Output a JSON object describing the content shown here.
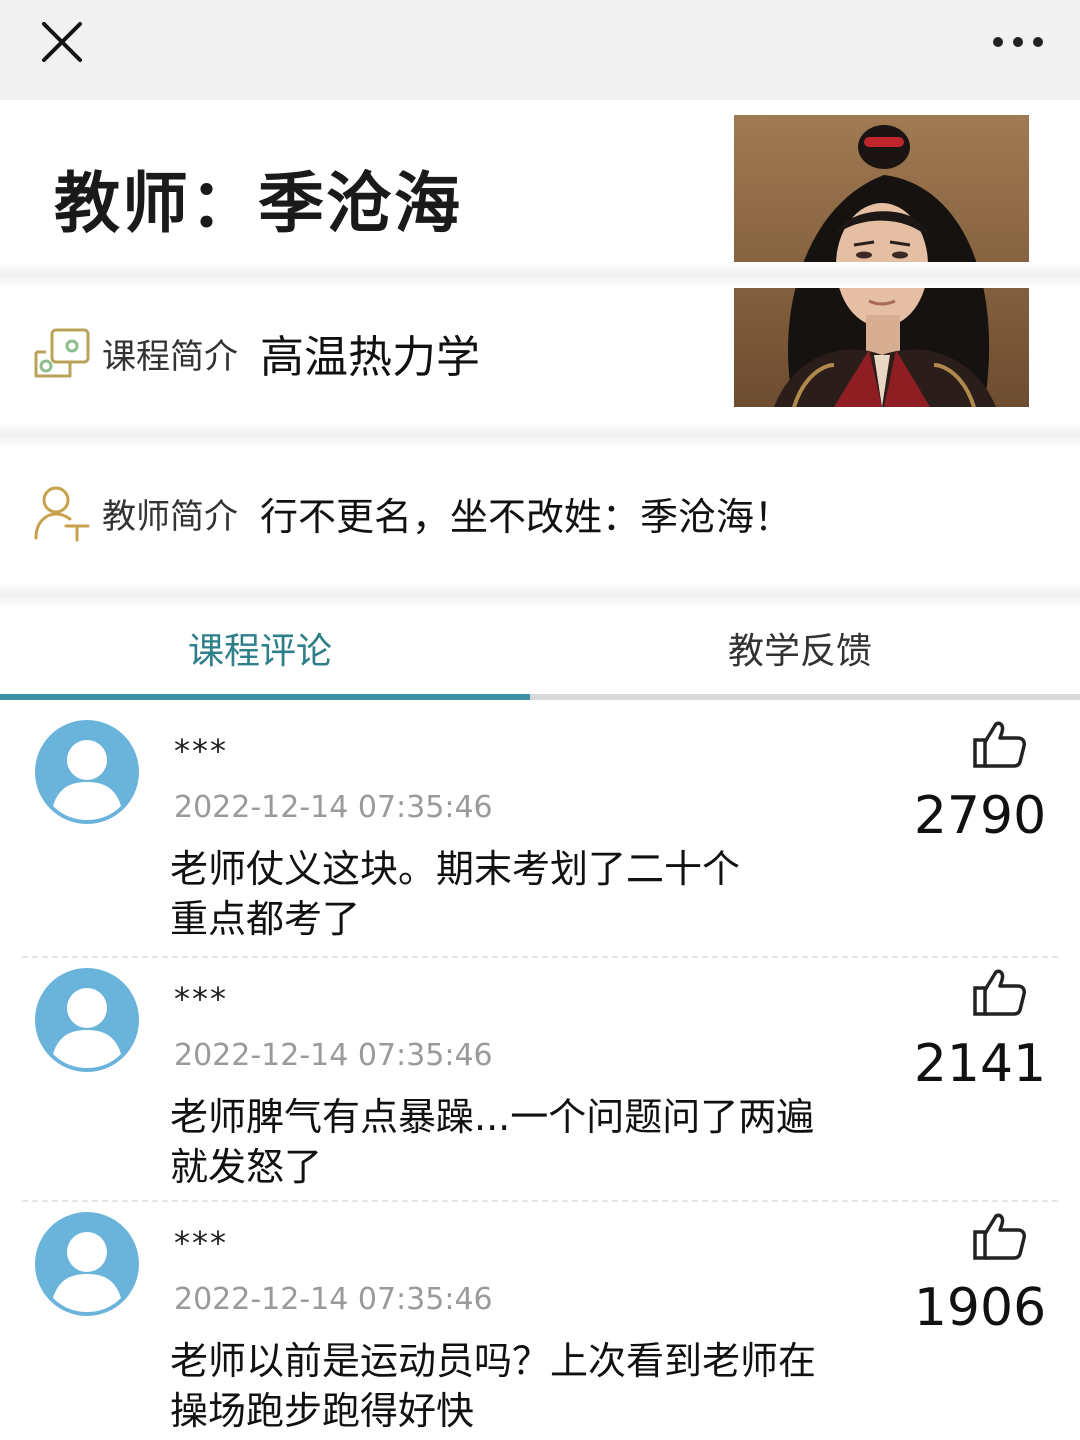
{
  "header": {
    "close_icon": "close-icon",
    "more_icon": "more-horizontal-icon"
  },
  "teacher": {
    "title": "教师：季沧海",
    "portrait_alt": "teacher-portrait"
  },
  "course": {
    "label": "课程简介",
    "value": "高温热力学",
    "icon": "course-intro-icon"
  },
  "teacher_intro": {
    "label": "教师简介",
    "value": "行不更名，坐不改姓：季沧海！",
    "icon": "teacher-intro-icon"
  },
  "tabs": [
    {
      "label": "课程评论",
      "active": true
    },
    {
      "label": "教学反馈",
      "active": false
    }
  ],
  "colors": {
    "accent": "#3b8fa3",
    "avatar": "#6ab4dc"
  },
  "comments": [
    {
      "user": "***",
      "time": "2022-12-14 07:35:46",
      "text_line1": "老师仗义这块。期末考划了二十个",
      "text_line2": "重点都考了",
      "likes": "2790"
    },
    {
      "user": "***",
      "time": "2022-12-14 07:35:46",
      "text_line1": "老师脾气有点暴躁...一个问题问了两遍",
      "text_line2": "就发怒了",
      "likes": "2141"
    },
    {
      "user": "***",
      "time": "2022-12-14 07:35:46",
      "text_line1": "老师以前是运动员吗？上次看到老师在",
      "text_line2": "操场跑步跑得好快",
      "likes": "1906"
    }
  ]
}
